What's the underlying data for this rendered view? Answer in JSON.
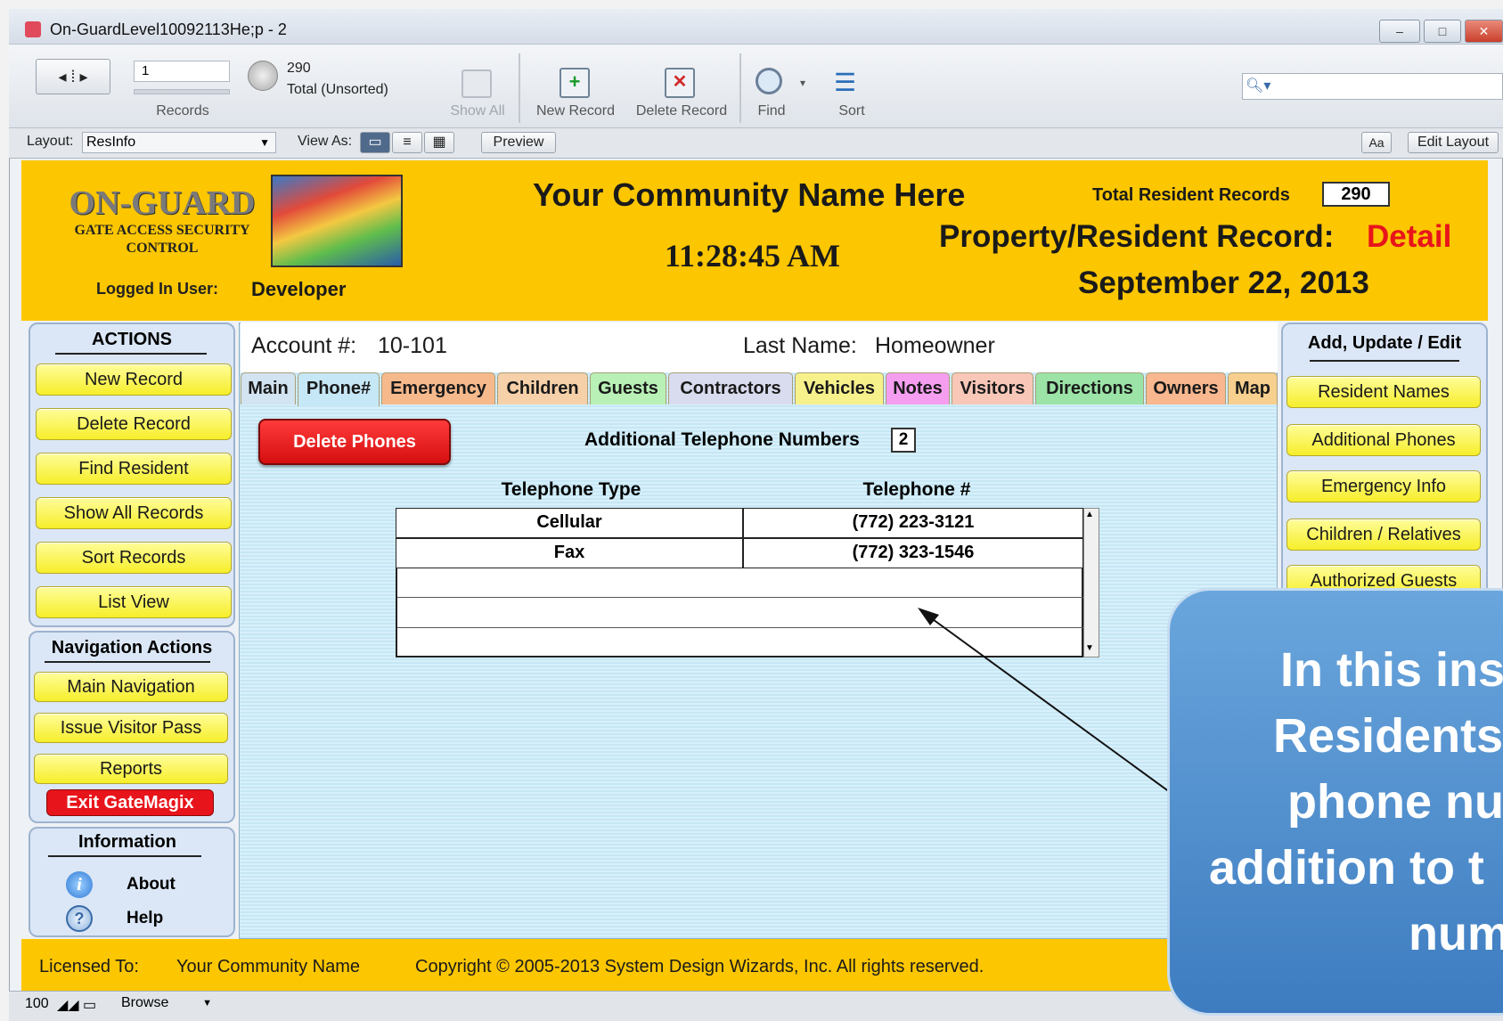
{
  "window": {
    "title": "On-GuardLevel10092113He;p - 2"
  },
  "toolbar": {
    "record_number": "1",
    "records_label": "Records",
    "total_count": "290",
    "total_label": "Total (Unsorted)",
    "show_all": "Show All",
    "new_record": "New Record",
    "delete_record": "Delete Record",
    "find": "Find",
    "sort": "Sort"
  },
  "layoutbar": {
    "layout_label": "Layout:",
    "layout_value": "ResInfo",
    "view_as": "View As:",
    "preview": "Preview",
    "font_btn": "Aa",
    "edit_layout": "Edit Layout"
  },
  "header": {
    "logo_title": "ON-GUARD",
    "logo_sub1": "GATE ACCESS SECURITY",
    "logo_sub2": "CONTROL",
    "logged_in_label": "Logged In User:",
    "logged_in_user": "Developer",
    "community": "Your Community Name Here",
    "time": "11:28:45 AM",
    "total_label": "Total Resident Records",
    "total_value": "290",
    "record_title": "Property/Resident Record:",
    "record_mode": "Detail",
    "date": "September 22, 2013"
  },
  "actions": {
    "title": "ACTIONS",
    "items": [
      "New Record",
      "Delete Record",
      "Find Resident",
      "Show All Records",
      "Sort Records",
      "List View"
    ]
  },
  "navigation": {
    "title": "Navigation Actions",
    "items": [
      "Main Navigation",
      "Issue Visitor Pass",
      "Reports"
    ],
    "exit": "Exit GateMagix"
  },
  "information": {
    "title": "Information",
    "about": "About",
    "help": "Help"
  },
  "record": {
    "account_label": "Account #:",
    "account_value": "10-101",
    "lastname_label": "Last Name:",
    "lastname_value": "Homeowner"
  },
  "tabs": [
    "Main",
    "Phone#",
    "Emergency",
    "Children",
    "Guests",
    "Contractors",
    "Vehicles",
    "Notes",
    "Visitors",
    "Directions",
    "Owners",
    "Map"
  ],
  "phones": {
    "delete_btn": "Delete Phones",
    "additional_label": "Additional Telephone Numbers",
    "additional_count": "2",
    "col_type": "Telephone Type",
    "col_number": "Telephone #",
    "rows": [
      {
        "type": "Cellular",
        "number": "(772) 223-3121"
      },
      {
        "type": "Fax",
        "number": "(772) 323-1546"
      }
    ]
  },
  "right_panel": {
    "title": "Add, Update / Edit",
    "items": [
      "Resident Names",
      "Additional Phones",
      "Emergency Info",
      "Children / Relatives",
      "Authorized Guests"
    ]
  },
  "footer": {
    "licensed_label": "Licensed To:",
    "licensed_value": "Your Community Name",
    "copyright": "Copyright © 2005-2013 System Design Wizards, Inc. All rights reserved."
  },
  "statusbar": {
    "zoom": "100",
    "mode": "Browse"
  },
  "callout": {
    "lines": [
      "In this ins",
      "Residents",
      "phone nu",
      "addition to t",
      "num"
    ]
  },
  "colors": {
    "header_yellow": "#fcc600",
    "button_yellow": "#f6ee2a",
    "exit_red": "#e8141b",
    "callout_blue": "#4f8fce"
  }
}
